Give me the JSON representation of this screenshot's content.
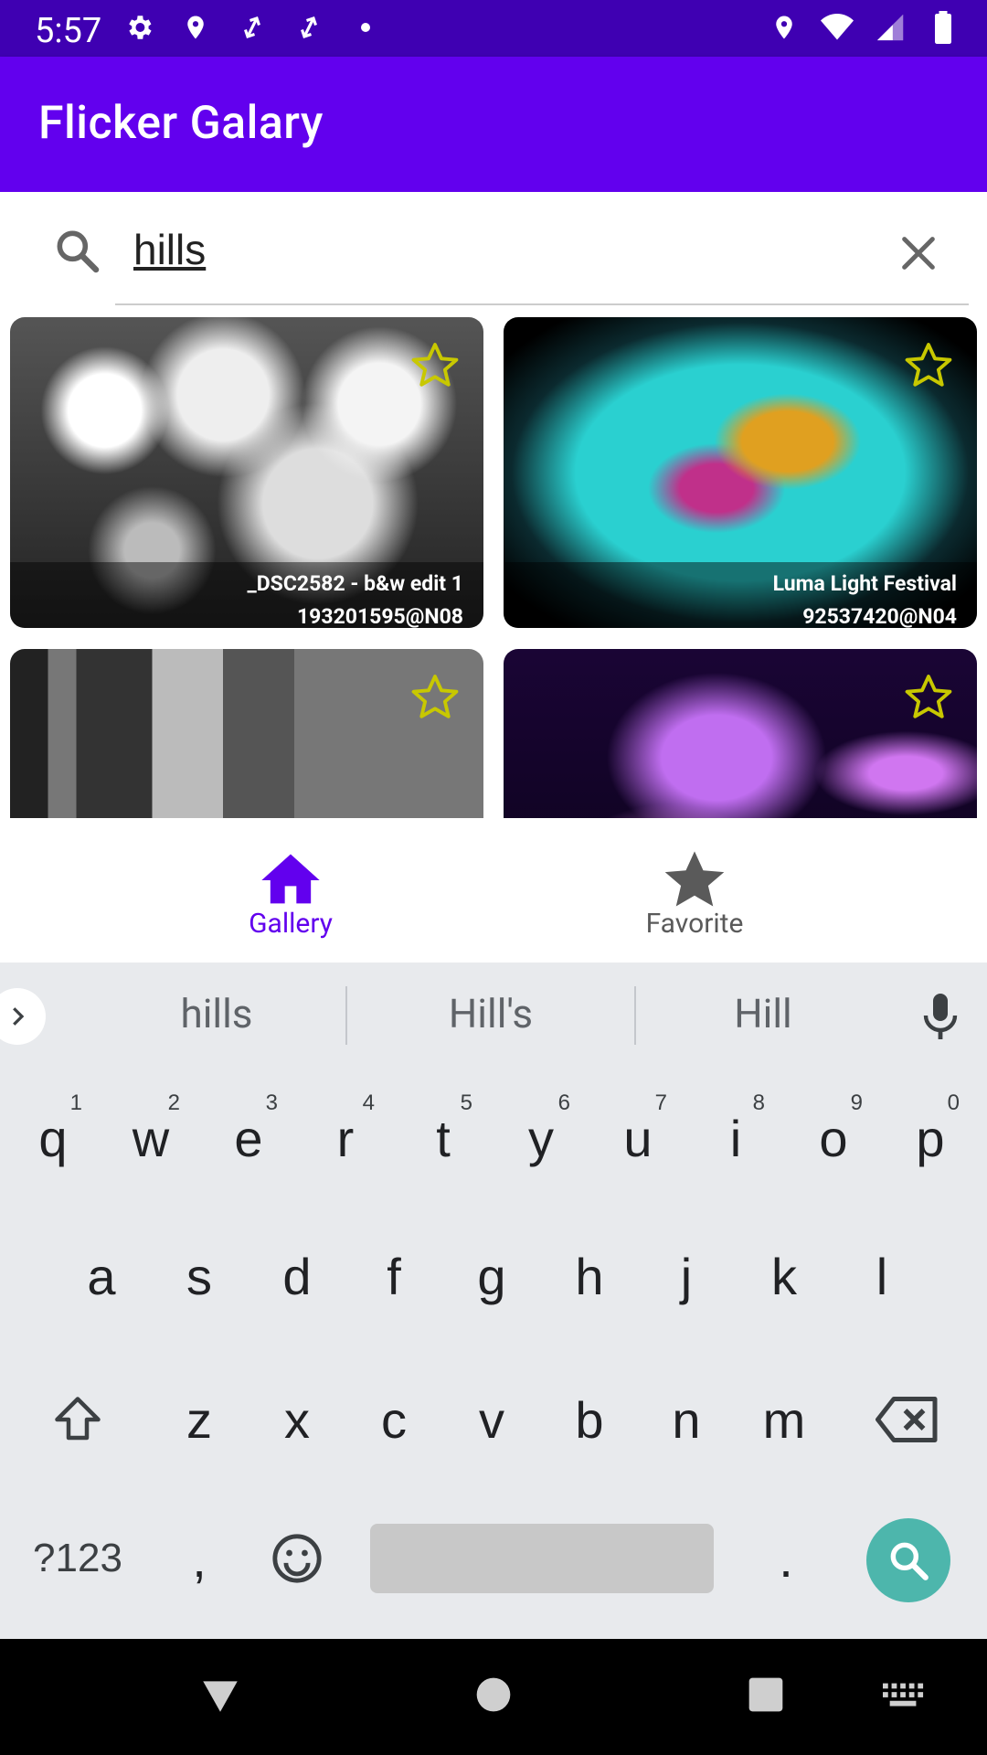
{
  "status_bar": {
    "time": "5:57",
    "left_icons": [
      "settings-icon",
      "location-icon",
      "sync-icon",
      "sync-icon",
      "dot-icon"
    ],
    "right_icons": [
      "location-icon",
      "wifi-icon",
      "signal-icon",
      "battery-icon"
    ]
  },
  "app_bar": {
    "title": "Flicker Galary"
  },
  "search": {
    "value": "hills",
    "placeholder": ""
  },
  "gallery": {
    "items": [
      {
        "title": "_DSC2582 - b&w edit 1",
        "owner": "193201595@N08",
        "favorite": false
      },
      {
        "title": "Luma Light Festival",
        "owner": "92537420@N04",
        "favorite": false
      },
      {
        "title": "",
        "owner": "",
        "favorite": false
      },
      {
        "title": "",
        "owner": "",
        "favorite": false
      }
    ]
  },
  "bottom_nav": {
    "items": [
      {
        "label": "Gallery",
        "icon": "home-icon",
        "selected": true
      },
      {
        "label": "Favorite",
        "icon": "star-icon",
        "selected": false
      }
    ]
  },
  "keyboard": {
    "suggestions": [
      "hills",
      "Hill's",
      "Hill"
    ],
    "row1": [
      "q",
      "w",
      "e",
      "r",
      "t",
      "y",
      "u",
      "i",
      "o",
      "p"
    ],
    "row1_hints": [
      "1",
      "2",
      "3",
      "4",
      "5",
      "6",
      "7",
      "8",
      "9",
      "0"
    ],
    "row2": [
      "a",
      "s",
      "d",
      "f",
      "g",
      "h",
      "j",
      "k",
      "l"
    ],
    "row3": [
      "z",
      "x",
      "c",
      "v",
      "b",
      "n",
      "m"
    ],
    "symbols_label": "?123",
    "comma": ",",
    "period": "."
  },
  "colors": {
    "primary": "#6200EE",
    "primary_dark": "#3F00B2",
    "star_outline": "#C8C800",
    "search_key": "#4DB6AC"
  }
}
